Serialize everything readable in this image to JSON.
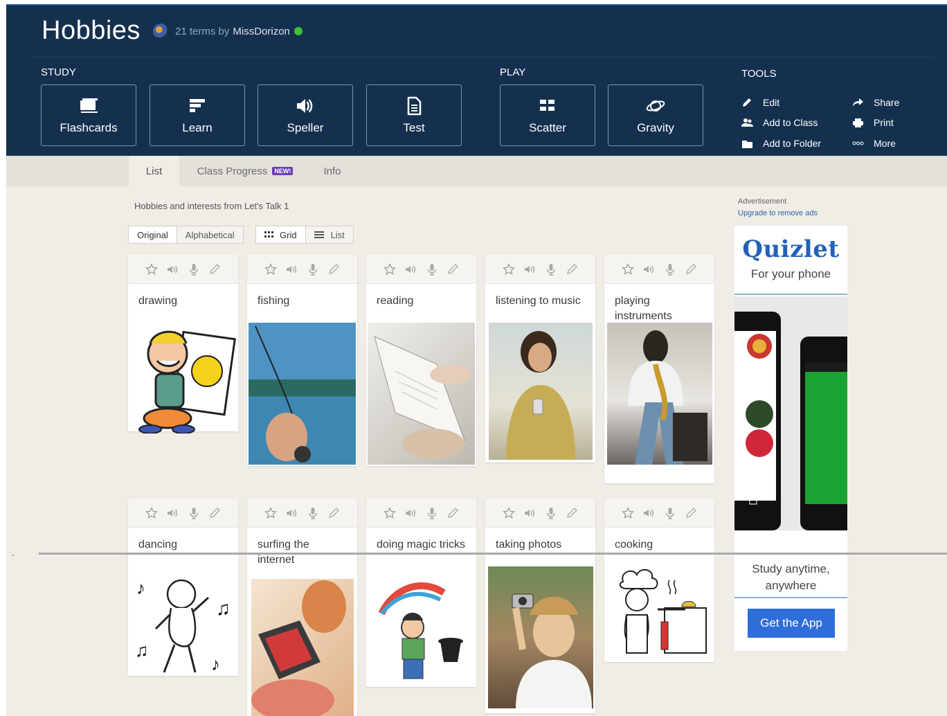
{
  "set": {
    "title": "Hobbies",
    "terms_text": "21 terms by",
    "author": "MissDorizon",
    "description": "Hobbies and interests from Let's Talk 1"
  },
  "sections": {
    "study": "STUDY",
    "play": "PLAY",
    "tools": "TOOLS"
  },
  "study_modes": [
    "Flashcards",
    "Learn",
    "Speller",
    "Test"
  ],
  "play_modes": [
    "Scatter",
    "Gravity"
  ],
  "tools": [
    "Edit",
    "Share",
    "Add to Class",
    "Print",
    "Add to Folder",
    "More"
  ],
  "tabs": {
    "list": "List",
    "progress": "Class Progress",
    "new_badge": "NEW!",
    "info": "Info"
  },
  "sort": {
    "original": "Original",
    "alphabetical": "Alphabetical"
  },
  "view": {
    "grid": "Grid",
    "list": "List"
  },
  "cards": [
    {
      "term": "drawing"
    },
    {
      "term": "fishing"
    },
    {
      "term": "reading"
    },
    {
      "term": "listening to music"
    },
    {
      "term": "playing instruments"
    },
    {
      "term": "dancing"
    },
    {
      "term": "surfing the internet"
    },
    {
      "term": "doing magic tricks"
    },
    {
      "term": "taking photos"
    },
    {
      "term": "cooking"
    }
  ],
  "ad": {
    "label": "Advertisement",
    "upgrade": "Upgrade to remove ads",
    "brand": "Quizlet",
    "tagline": "For your phone",
    "study_line1": "Study anytime,",
    "study_line2": "anywhere",
    "cta": "Get the App"
  },
  "colors": {
    "header": "#15304f",
    "accent": "#2f6ed8",
    "online": "#3fbf3a",
    "page": "#efede6"
  }
}
